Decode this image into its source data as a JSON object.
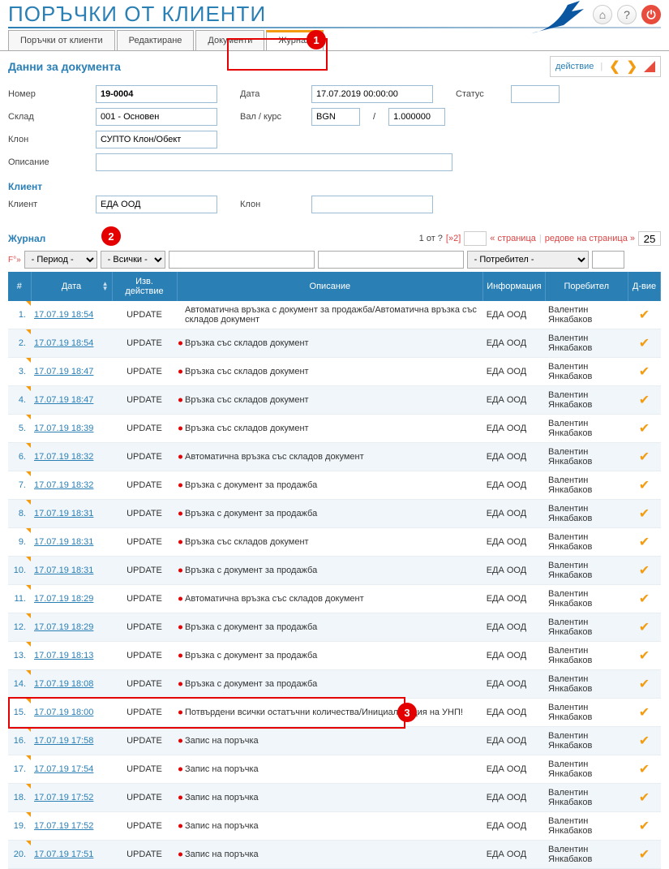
{
  "page_title": "ПОРЪЧКИ ОТ КЛИЕНТИ",
  "tabs": [
    "Поръчки от клиенти",
    "Редактиране",
    "Документи",
    "Журнал"
  ],
  "active_tab_index": 3,
  "doc_data_header": "Данни за документа",
  "action_label": "действие",
  "form": {
    "number_label": "Номер",
    "number_value": "19-0004",
    "date_label": "Дата",
    "date_value": "17.07.2019 00:00:00",
    "status_label": "Статус",
    "status_value": "",
    "warehouse_label": "Склад",
    "warehouse_value": "001 - Основен",
    "currency_label": "Вал / курс",
    "currency_value": "BGN",
    "rate_value": "1.000000",
    "branch_label": "Клон",
    "branch_value": "СУПТО Клон/Обект",
    "description_label": "Описание",
    "description_value": "",
    "client_section": "Клиент",
    "client_label": "Клиент",
    "client_value": "ЕДА ООД",
    "client_branch_label": "Клон",
    "client_branch_value": ""
  },
  "journal_title": "Журнал",
  "pagination": {
    "info": "1 от ?",
    "go": "[»2]",
    "page_label": "« страница",
    "rows_label": "редове на страница »",
    "rows_value": "25"
  },
  "filters": {
    "f_label": "F°»",
    "period": "- Период -",
    "all": "- Всички -",
    "user": "- Потребител -"
  },
  "columns": [
    "#",
    "Дата",
    "Изв. действие",
    "Описание",
    "Информация",
    "Поребител",
    "Д-вие"
  ],
  "rows": [
    {
      "idx": "1.",
      "date": "17.07.19 18:54",
      "act": "UPDATE",
      "desc": "Автоматична връзка с документ за продажба/Автоматична връзка със складов документ",
      "info": "ЕДА ООД",
      "user": "Валентин Янкабаков",
      "dot": false
    },
    {
      "idx": "2.",
      "date": "17.07.19 18:54",
      "act": "UPDATE",
      "desc": "Връзка със складов документ",
      "info": "ЕДА ООД",
      "user": "Валентин Янкабаков",
      "dot": true
    },
    {
      "idx": "3.",
      "date": "17.07.19 18:47",
      "act": "UPDATE",
      "desc": "Връзка със складов документ",
      "info": "ЕДА ООД",
      "user": "Валентин Янкабаков",
      "dot": true
    },
    {
      "idx": "4.",
      "date": "17.07.19 18:47",
      "act": "UPDATE",
      "desc": "Връзка със складов документ",
      "info": "ЕДА ООД",
      "user": "Валентин Янкабаков",
      "dot": true
    },
    {
      "idx": "5.",
      "date": "17.07.19 18:39",
      "act": "UPDATE",
      "desc": "Връзка със складов документ",
      "info": "ЕДА ООД",
      "user": "Валентин Янкабаков",
      "dot": true
    },
    {
      "idx": "6.",
      "date": "17.07.19 18:32",
      "act": "UPDATE",
      "desc": "Автоматична връзка със складов документ",
      "info": "ЕДА ООД",
      "user": "Валентин Янкабаков",
      "dot": true
    },
    {
      "idx": "7.",
      "date": "17.07.19 18:32",
      "act": "UPDATE",
      "desc": "Връзка с документ за продажба",
      "info": "ЕДА ООД",
      "user": "Валентин Янкабаков",
      "dot": true
    },
    {
      "idx": "8.",
      "date": "17.07.19 18:31",
      "act": "UPDATE",
      "desc": "Връзка с документ за продажба",
      "info": "ЕДА ООД",
      "user": "Валентин Янкабаков",
      "dot": true
    },
    {
      "idx": "9.",
      "date": "17.07.19 18:31",
      "act": "UPDATE",
      "desc": "Връзка със складов документ",
      "info": "ЕДА ООД",
      "user": "Валентин Янкабаков",
      "dot": true
    },
    {
      "idx": "10.",
      "date": "17.07.19 18:31",
      "act": "UPDATE",
      "desc": "Връзка с документ за продажба",
      "info": "ЕДА ООД",
      "user": "Валентин Янкабаков",
      "dot": true
    },
    {
      "idx": "11.",
      "date": "17.07.19 18:29",
      "act": "UPDATE",
      "desc": "Автоматична връзка със складов документ",
      "info": "ЕДА ООД",
      "user": "Валентин Янкабаков",
      "dot": true
    },
    {
      "idx": "12.",
      "date": "17.07.19 18:29",
      "act": "UPDATE",
      "desc": "Връзка с документ за продажба",
      "info": "ЕДА ООД",
      "user": "Валентин Янкабаков",
      "dot": true
    },
    {
      "idx": "13.",
      "date": "17.07.19 18:13",
      "act": "UPDATE",
      "desc": "Връзка с документ за продажба",
      "info": "ЕДА ООД",
      "user": "Валентин Янкабаков",
      "dot": true
    },
    {
      "idx": "14.",
      "date": "17.07.19 18:08",
      "act": "UPDATE",
      "desc": "Връзка с документ за продажба",
      "info": "ЕДА ООД",
      "user": "Валентин Янкабаков",
      "dot": true
    },
    {
      "idx": "15.",
      "date": "17.07.19 18:00",
      "act": "UPDATE",
      "desc": "Потвърдени всички остатъчни количества/Инициализация на УНП!",
      "info": "ЕДА ООД",
      "user": "Валентин Янкабаков",
      "dot": true
    },
    {
      "idx": "16.",
      "date": "17.07.19 17:58",
      "act": "UPDATE",
      "desc": "Запис на поръчка",
      "info": "ЕДА ООД",
      "user": "Валентин Янкабаков",
      "dot": true
    },
    {
      "idx": "17.",
      "date": "17.07.19 17:54",
      "act": "UPDATE",
      "desc": "Запис на поръчка",
      "info": "ЕДА ООД",
      "user": "Валентин Янкабаков",
      "dot": true
    },
    {
      "idx": "18.",
      "date": "17.07.19 17:52",
      "act": "UPDATE",
      "desc": "Запис на поръчка",
      "info": "ЕДА ООД",
      "user": "Валентин Янкабаков",
      "dot": true
    },
    {
      "idx": "19.",
      "date": "17.07.19 17:52",
      "act": "UPDATE",
      "desc": "Запис на поръчка",
      "info": "ЕДА ООД",
      "user": "Валентин Янкабаков",
      "dot": true
    },
    {
      "idx": "20.",
      "date": "17.07.19 17:51",
      "act": "UPDATE",
      "desc": "Запис на поръчка",
      "info": "ЕДА ООД",
      "user": "Валентин Янкабаков",
      "dot": true
    }
  ],
  "callouts": {
    "c1": "1",
    "c2": "2",
    "c3": "3"
  }
}
